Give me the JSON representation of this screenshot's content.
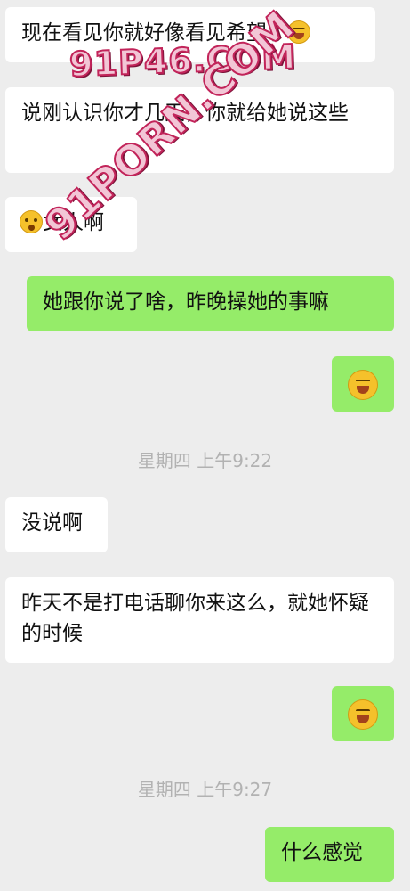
{
  "messages": [
    {
      "side": "left",
      "text": "现在看见你就好像看见希望了",
      "suffix_emoji": "laughing-crying-emoji"
    },
    {
      "side": "left",
      "text": "说刚认识你才几天，你就给她说这些"
    },
    {
      "side": "left",
      "prefix_emoji": "frown-emoji",
      "text": "女人啊"
    },
    {
      "side": "right",
      "text": "她跟你说了啥，昨晚操她的事嘛"
    },
    {
      "side": "right",
      "emoji_only": "laughing-crying-emoji"
    },
    {
      "side": "left",
      "text": "没说啊"
    },
    {
      "side": "left",
      "text": "昨天不是打电话聊你来这么，就她怀疑的时候"
    },
    {
      "side": "right",
      "emoji_only": "laughing-crying-emoji"
    },
    {
      "side": "right",
      "text": "什么感觉"
    }
  ],
  "timestamps": [
    "星期四 上午9:22",
    "星期四 上午9:27"
  ],
  "watermarks": [
    "91P46.COM",
    "91PORN.COM"
  ],
  "colors": {
    "background": "#ededed",
    "incoming_bubble": "#ffffff",
    "outgoing_bubble": "#95ec69",
    "timestamp": "#b2b2b2"
  }
}
